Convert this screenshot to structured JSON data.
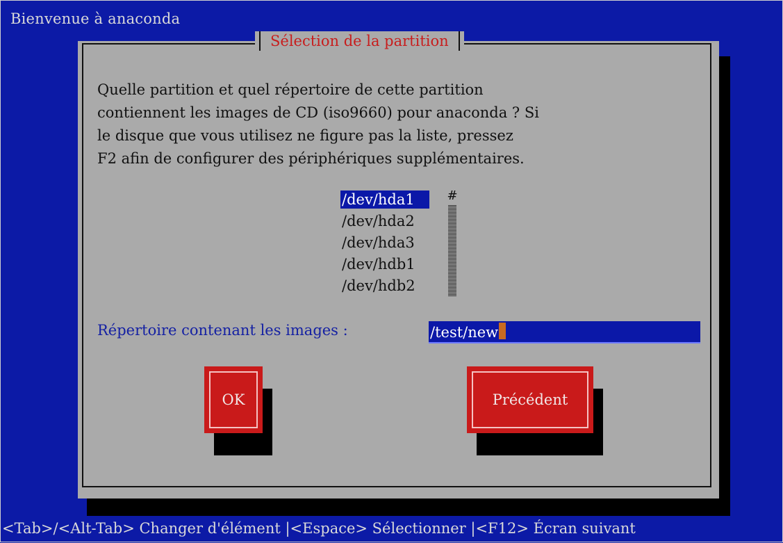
{
  "window": {
    "title": "Bienvenue à anaconda"
  },
  "dialog": {
    "title": "Sélection de la partition",
    "question_lines": [
      "Quelle partition et quel répertoire de cette partition",
      "contiennent les images de CD (iso9660) pour anaconda ? Si",
      "le disque que vous utilisez ne figure pas la liste, pressez",
      "F2 afin de configurer des périphériques supplémentaires."
    ],
    "partitions": [
      {
        "label": "/dev/hda1",
        "selected": true
      },
      {
        "label": "/dev/hda2",
        "selected": false
      },
      {
        "label": "/dev/hda3",
        "selected": false
      },
      {
        "label": "/dev/hdb1",
        "selected": false
      },
      {
        "label": "/dev/hdb2",
        "selected": false
      }
    ],
    "scrollbar_thumb": "#",
    "directory_label": "Répertoire contenant les images :",
    "directory_value": "/test/new",
    "buttons": {
      "ok": "OK",
      "back": "Précédent"
    }
  },
  "footer": {
    "hint": "<Tab>/<Alt-Tab> Changer d'élément |<Espace> Sélectionner |<F12> Écran suivant"
  },
  "colors": {
    "background": "#0c1aa6",
    "dialog": "#aaaaaa",
    "accent_red": "#c91a1a",
    "selection_blue": "#0b18a8"
  }
}
